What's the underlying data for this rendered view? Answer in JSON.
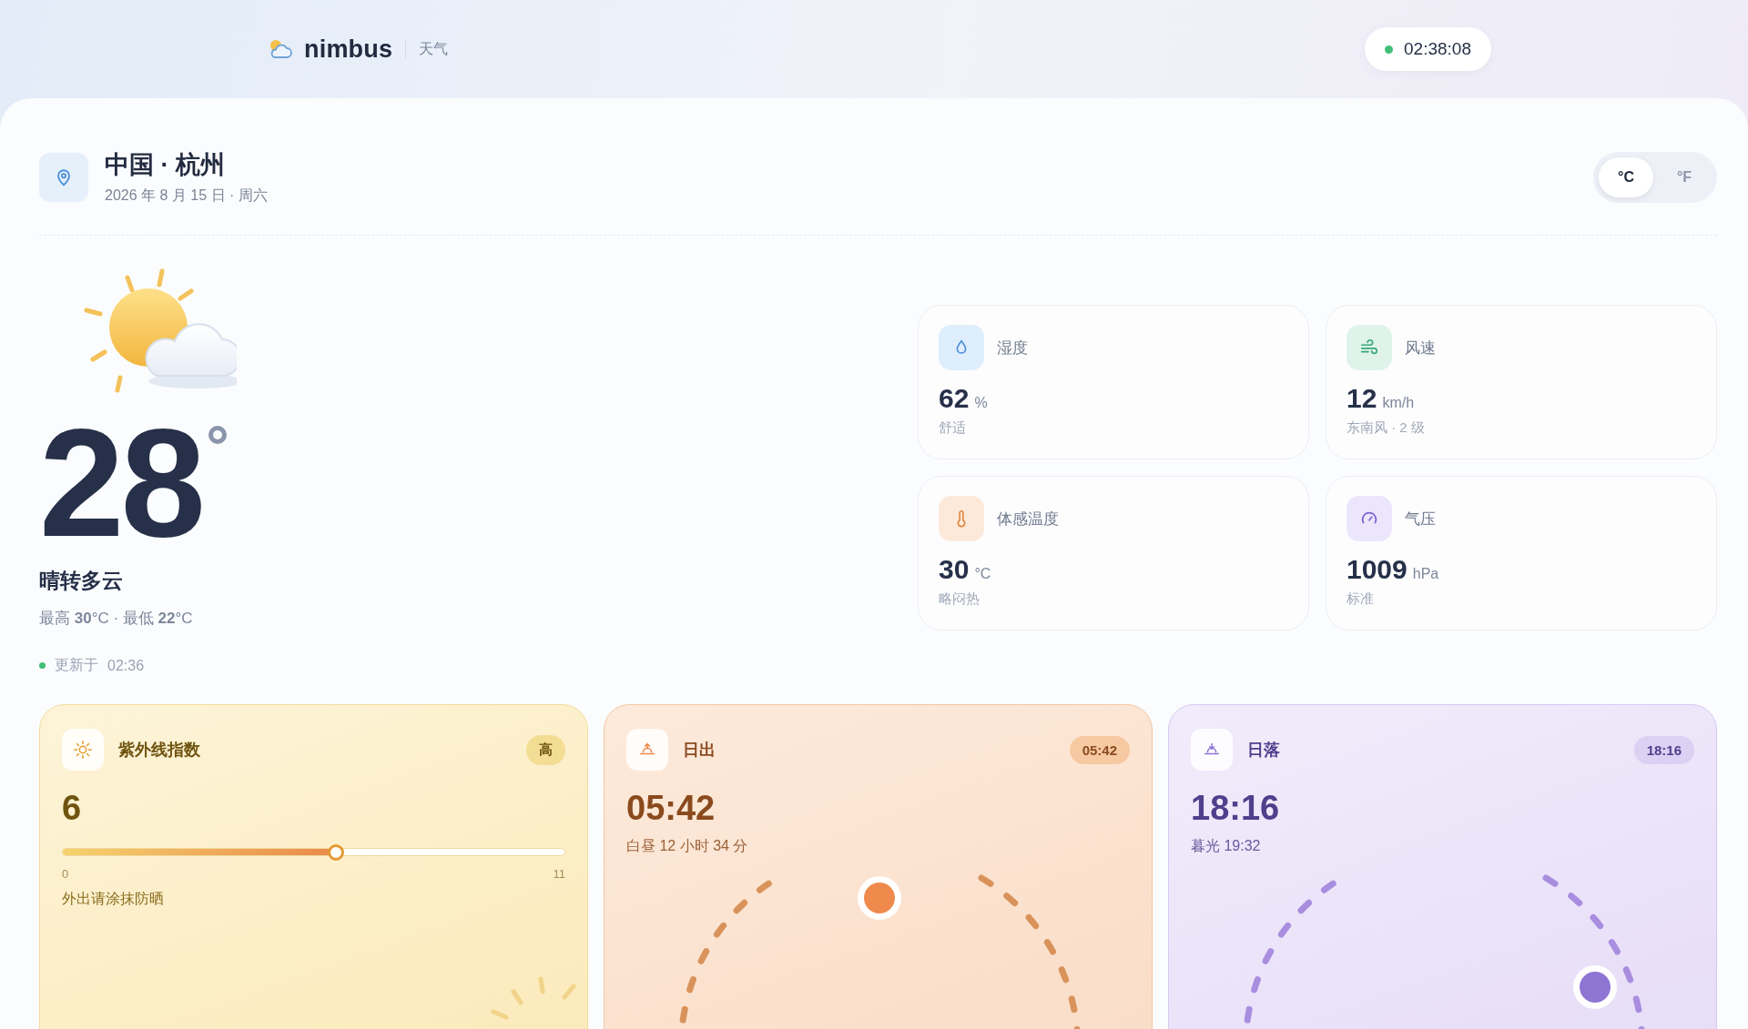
{
  "header": {
    "brand": "nimbus",
    "subtitle": "天气",
    "clock": "02:38:08"
  },
  "location": {
    "title": "中国 · 杭州",
    "date": "2026 年 8 月 15 日 · 周六"
  },
  "unit_toggle": [
    {
      "label": "°C",
      "selected": true
    },
    {
      "label": "°F",
      "selected": false
    }
  ],
  "current": {
    "temperature": "28",
    "condition": "晴转多云",
    "hilo": "最高 **30**°C · 最低 **22**°C",
    "updated_label": "更新于",
    "updated_time": "02:36"
  },
  "stats": [
    {
      "kind": "humidity",
      "label": "湿度",
      "value": "62",
      "unit": "%",
      "note": "舒适"
    },
    {
      "kind": "wind",
      "label": "风速",
      "value": "12",
      "unit": "km/h",
      "note": "东南风 · 2 级"
    },
    {
      "kind": "feels",
      "label": "体感温度",
      "value": "30",
      "unit": "°C",
      "note": "略闷热"
    },
    {
      "kind": "pressure",
      "label": "气压",
      "value": "1009",
      "unit": "hPa",
      "note": "标准"
    }
  ],
  "uv": {
    "title": "紫外线指数",
    "badge": "高",
    "value": "6",
    "level": 0.545,
    "min": "0",
    "max": "11",
    "advice": "外出请涂抹防晒"
  },
  "sun_cards": [
    {
      "kind": "sunrise",
      "title": "日出",
      "badge": "05:42",
      "time": "05:42",
      "note": "白昼 12 小时 34 分"
    },
    {
      "kind": "sunset",
      "title": "日落",
      "badge": "18:16",
      "time": "18:16",
      "note": "暮光 19:32"
    }
  ]
}
